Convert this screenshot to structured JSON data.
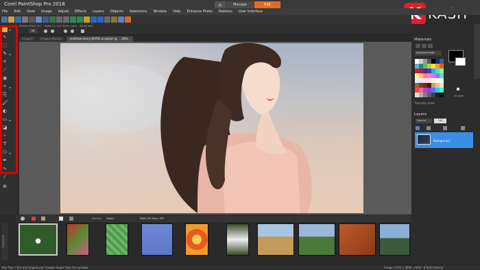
{
  "app": {
    "title": "Corel PaintShop Pro 2018",
    "workspace_tabs": {
      "home_icon": "home-icon",
      "manage": "Manage",
      "edit": "Edit"
    }
  },
  "menu": [
    "File",
    "Edit",
    "View",
    "Image",
    "Adjust",
    "Effects",
    "Layers",
    "Objects",
    "Selections",
    "Window",
    "Help",
    "Enhance Photo",
    "Palettes",
    "User Interface"
  ],
  "tool_options": {
    "presets": "Presets",
    "zoom_label": "Zoom (%):",
    "zoom_value": "28",
    "zoom_in_out": "Zoom in / out",
    "zoom_more": "Zoom more",
    "actual_size": "Actual size"
  },
  "doc_tabs": [
    {
      "label": "Image1*"
    },
    {
      "label": "Image2 (Raster)"
    },
    {
      "label": "matthew-henry-69791-unsplash @ ... 28%..."
    }
  ],
  "organizer": {
    "tab_label": "Organizer",
    "sort_by": "Sort by:",
    "sort_value": "Folder",
    "raw_label": "RAW UP3 Pairs: OFF"
  },
  "materials": {
    "title": "Materials",
    "palette": "Standard Palet",
    "recently_used": "Recently Used",
    "transparency": "All tools"
  },
  "layers": {
    "title": "Layers",
    "blend": "Normal",
    "opacity": "100",
    "layer_name": "Background"
  },
  "status": {
    "hint": "Pan Tool: Click and drag to pan images larger than the window.",
    "image_info": "Image: 4703 x 2660 x RGB - 8 bits/channel"
  },
  "logo": {
    "mark": "K",
    "text": "KASH"
  },
  "colors": {
    "edit_tab": "#e66a1f",
    "highlight": "#e00000",
    "layer_selected": "#3a8ee6",
    "logo_red": "#e21f26"
  }
}
